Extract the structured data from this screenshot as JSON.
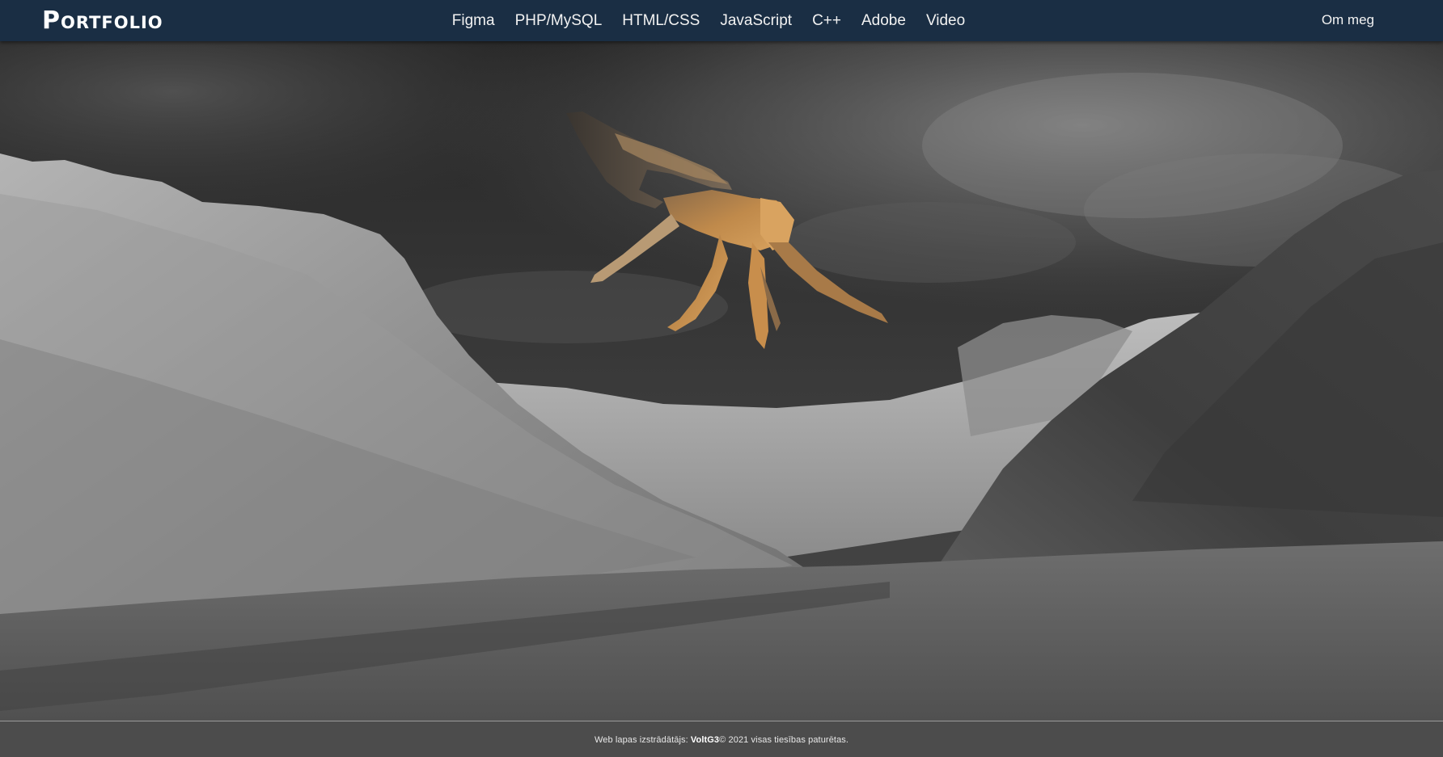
{
  "navbar": {
    "brand": "Portfolio",
    "links": [
      {
        "label": "Figma"
      },
      {
        "label": "PHP/MySQL"
      },
      {
        "label": "HTML/CSS"
      },
      {
        "label": "JavaScript"
      },
      {
        "label": "C++"
      },
      {
        "label": "Adobe"
      },
      {
        "label": "Video"
      }
    ],
    "about": "Om meg"
  },
  "footer": {
    "prefix": "Web lapas izstrādātājs: ",
    "author": "VoltG3",
    "suffix": " © 2021 visas tiesības paturētas."
  },
  "colors": {
    "navbar_bg": "#1a2e44",
    "driftwood": "#b07a3e"
  },
  "hero": {
    "image": "grayscale-mountain-valley-with-driftwood-sculpture"
  }
}
